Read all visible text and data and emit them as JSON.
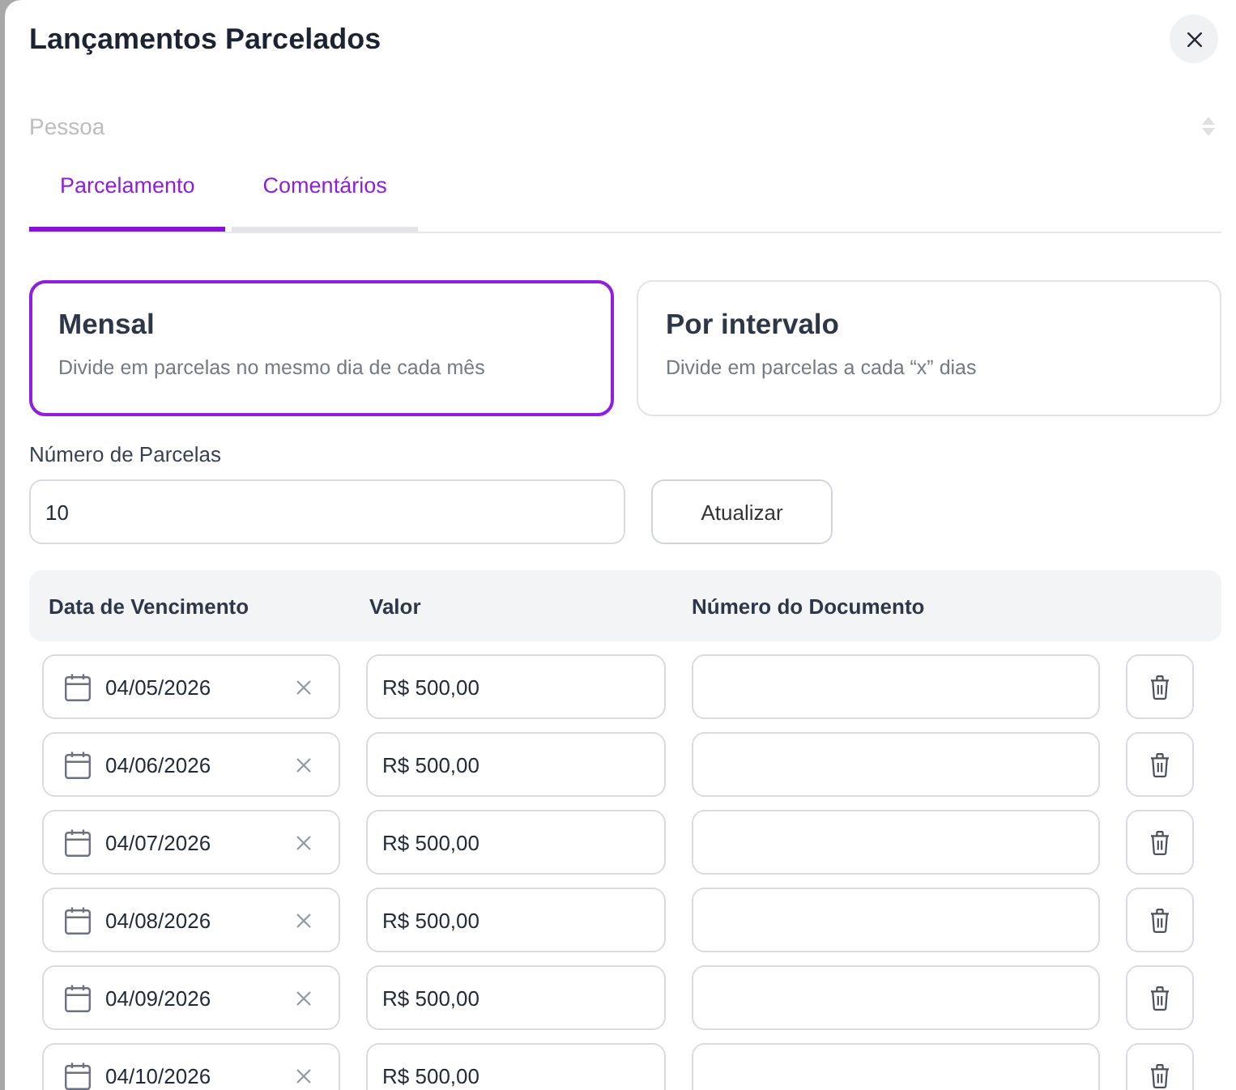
{
  "dialog": {
    "title": "Lançamentos Parcelados"
  },
  "person_field": {
    "placeholder": "Pessoa"
  },
  "tabs": [
    {
      "label": "Parcelamento",
      "selected": true
    },
    {
      "label": "Comentários",
      "selected": false
    }
  ],
  "split_modes": [
    {
      "title": "Mensal",
      "description": "Divide em parcelas no mesmo dia de cada mês",
      "selected": true
    },
    {
      "title": "Por intervalo",
      "description": "Divide em parcelas a cada “x” dias",
      "selected": false
    }
  ],
  "installment_count": {
    "label": "Número de Parcelas",
    "value": "10"
  },
  "update_button": {
    "label": "Atualizar"
  },
  "table": {
    "columns": [
      "Data de Vencimento",
      "Valor",
      "Número do Documento"
    ],
    "rows": [
      {
        "due_date": "04/05/2026",
        "amount": "R$ 500,00"
      },
      {
        "due_date": "04/06/2026",
        "amount": "R$ 500,00"
      },
      {
        "due_date": "04/07/2026",
        "amount": "R$ 500,00"
      },
      {
        "due_date": "04/08/2026",
        "amount": "R$ 500,00"
      },
      {
        "due_date": "04/09/2026",
        "amount": "R$ 500,00"
      },
      {
        "due_date": "04/10/2026",
        "amount": "R$ 500,00"
      }
    ]
  }
}
